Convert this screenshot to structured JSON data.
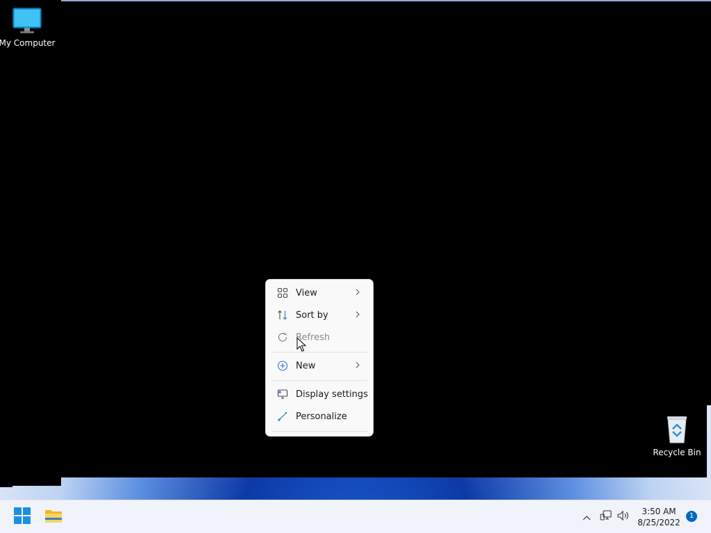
{
  "desktop": {
    "icons": [
      {
        "label": "My Computer"
      },
      {
        "label": "Recycle Bin"
      }
    ]
  },
  "context_menu": {
    "items": [
      {
        "label": "View",
        "icon": "grid-icon",
        "has_submenu": true
      },
      {
        "label": "Sort by",
        "icon": "sort-icon",
        "has_submenu": true
      },
      {
        "label": "Refresh",
        "icon": "refresh-icon",
        "disabled": true
      },
      {
        "label": "New",
        "icon": "plus-circle-icon",
        "has_submenu": true
      },
      {
        "label": "Display settings",
        "icon": "display-icon"
      },
      {
        "label": "Personalize",
        "icon": "brush-icon"
      }
    ]
  },
  "taskbar": {
    "time": "3:50 AM",
    "date": "8/25/2022",
    "notification_count": "1"
  },
  "colors": {
    "accent": "#0067c0",
    "menu_bg": "#f9f9f9",
    "taskbar_bg": "#f0f3f9"
  }
}
